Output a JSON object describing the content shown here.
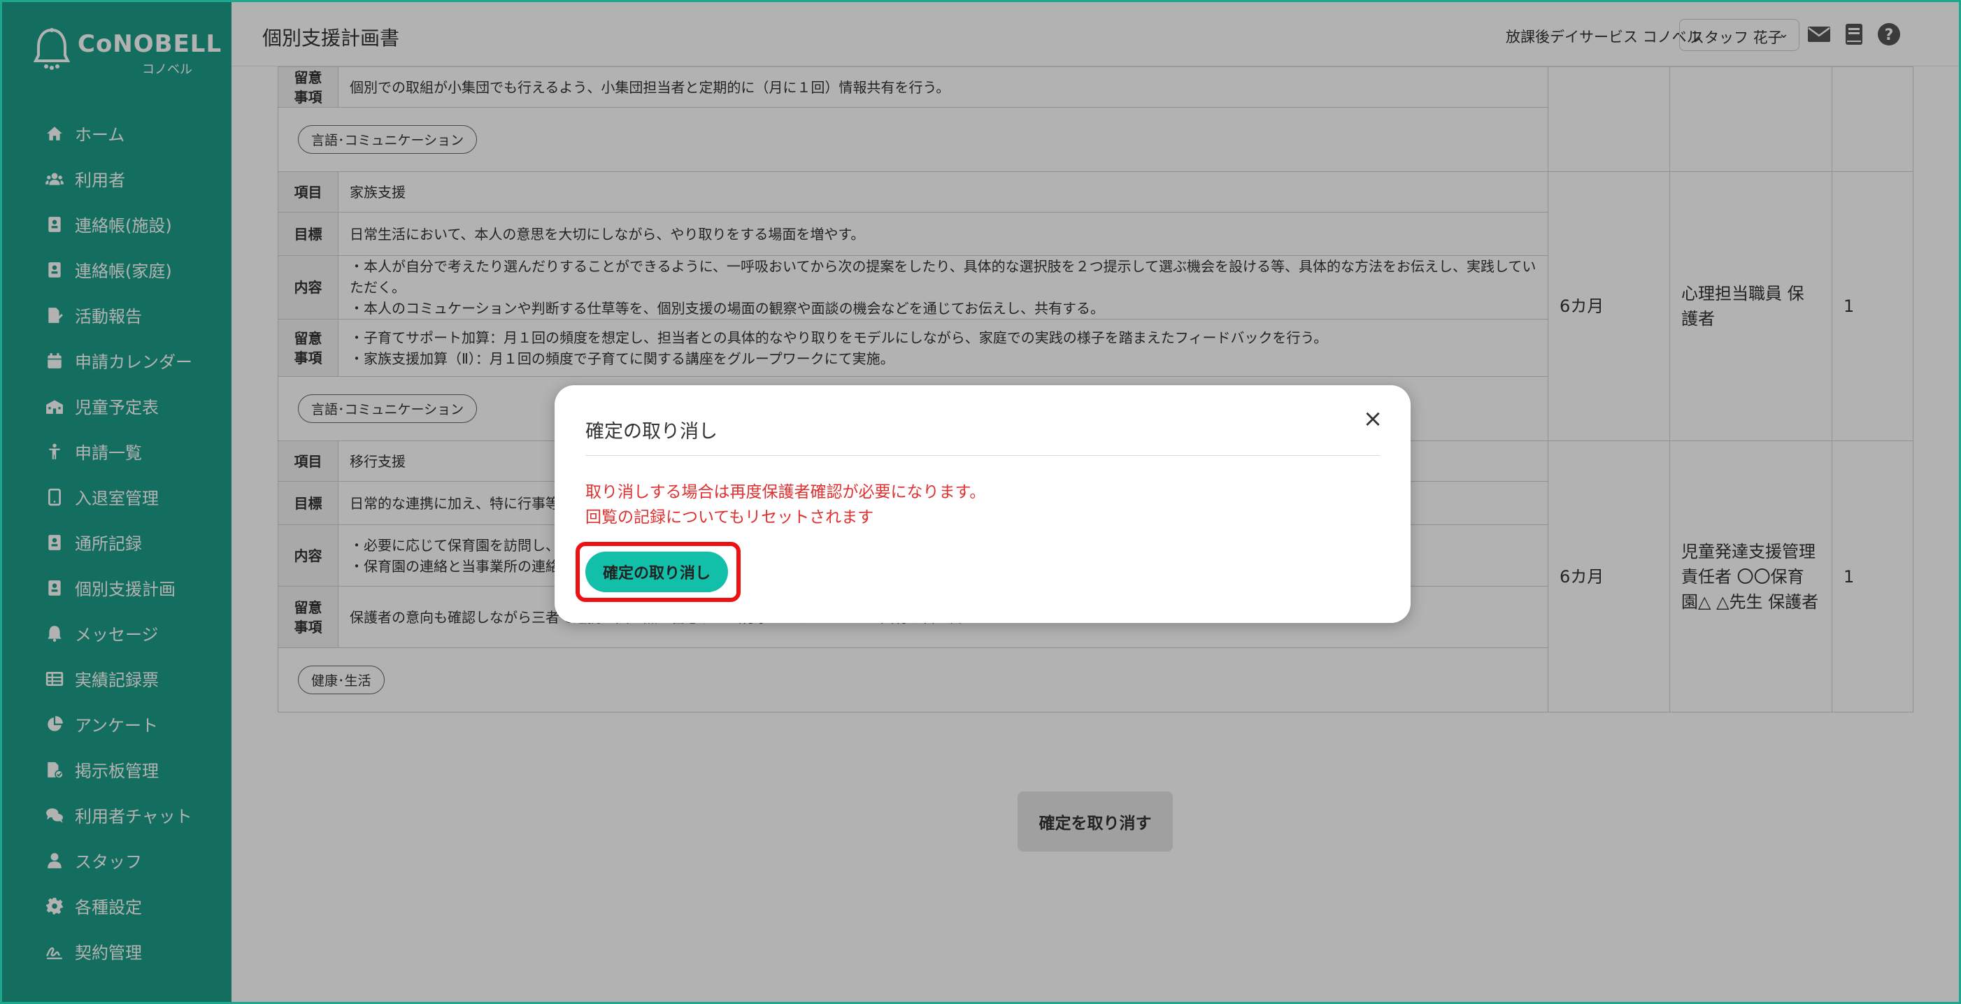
{
  "app": {
    "logo_text": "CoNOBELL",
    "logo_sub": "コノベル"
  },
  "sidebar": {
    "items": [
      {
        "label": "ホーム",
        "icon": "home-icon"
      },
      {
        "label": "利用者",
        "icon": "users-icon"
      },
      {
        "label": "連絡帳(施設)",
        "icon": "contact-book-icon"
      },
      {
        "label": "連絡帳(家庭)",
        "icon": "contact-book-icon"
      },
      {
        "label": "活動報告",
        "icon": "file-edit-icon"
      },
      {
        "label": "申請カレンダー",
        "icon": "calendar-icon"
      },
      {
        "label": "児童予定表",
        "icon": "school-icon"
      },
      {
        "label": "申請一覧",
        "icon": "child-icon"
      },
      {
        "label": "入退室管理",
        "icon": "tablet-icon"
      },
      {
        "label": "通所記録",
        "icon": "contact-book-icon"
      },
      {
        "label": "個別支援計画",
        "icon": "contact-book-icon"
      },
      {
        "label": "メッセージ",
        "icon": "bell-icon"
      },
      {
        "label": "実績記録票",
        "icon": "table-icon"
      },
      {
        "label": "アンケート",
        "icon": "pie-chart-icon"
      },
      {
        "label": "掲示板管理",
        "icon": "file-check-icon"
      },
      {
        "label": "利用者チャット",
        "icon": "chat-icon"
      },
      {
        "label": "スタッフ",
        "icon": "user-icon"
      },
      {
        "label": "各種設定",
        "icon": "gear-icon"
      },
      {
        "label": "契約管理",
        "icon": "signature-icon"
      }
    ]
  },
  "header": {
    "title": "個別支援計画書",
    "facility": "放課後デイサービス コノベル",
    "staff_selected": "スタッフ 花子"
  },
  "plan": {
    "top_section": {
      "note_label": "留意\n事項",
      "note": "個別での取組が小集団でも行えるよう、小集団担当者と定期的に（月に１回）情報共有を行う。",
      "tag": "言語･コミュニケーション"
    },
    "sections": [
      {
        "item_label": "項目",
        "item": "家族支援",
        "goal_label": "目標",
        "goal": "日常生活において、本人の意思を大切にしながら、やり取りをする場面を増やす。",
        "content_label": "内容",
        "content": [
          "・本人が自分で考えたり選んだりすることができるように、一呼吸おいてから次の提案をしたり、具体的な選択肢を２つ提示して選ぶ機会を設ける等、具体的な方法をお伝えし、実践していただく。",
          "・本人のコミュケーションや判断する仕草等を、個別支援の場面の観察や面談の機会などを通じてお伝えし、共有する。"
        ],
        "note_label": "留意\n事項",
        "note": [
          "・子育てサポート加算：月１回の頻度を想定し、担当者との具体的なやり取りをモデルにしながら、家庭での実践の様子を踏まえたフィードバックを行う。",
          "・家族支援加算（Ⅱ）：月１回の頻度で子育てに関する講座をグループワークにて実施。"
        ],
        "tag": "言語･コミュニケーション",
        "period": "6カ月",
        "staff": "心理担当職員 保護者",
        "priority": "1"
      },
      {
        "item_label": "項目",
        "item": "移行支援",
        "goal_label": "目標",
        "goal": "日常的な連携に加え、特に行事等",
        "content_label": "内容",
        "content": [
          "・必要に応じて保育園を訪問し、行",
          "・保育園の連絡と当事業所の連絡"
        ],
        "note_label": "留意\n事項",
        "note": [
          "保護者の意向も確認しながら三者で連携を図る点に留意する（行事のスケジュールの共有も含む）。"
        ],
        "tag": "健康･生活",
        "period": "6カ月",
        "staff": "児童発達支援管理責任者 〇〇保育園△ △先生 保護者",
        "priority": "1"
      }
    ],
    "footer_button": "確定を取り消す"
  },
  "modal": {
    "title": "確定の取り消し",
    "message_line1": "取り消しする場合は再度保護者確認が必要になります。",
    "message_line2": "回覧の記録についてもリセットされます",
    "button": "確定の取り消し"
  },
  "colors": {
    "sidebar": "#1c9e88",
    "accent": "#12bfa9",
    "warning_text": "#e03030",
    "highlight": "#ee1111"
  }
}
